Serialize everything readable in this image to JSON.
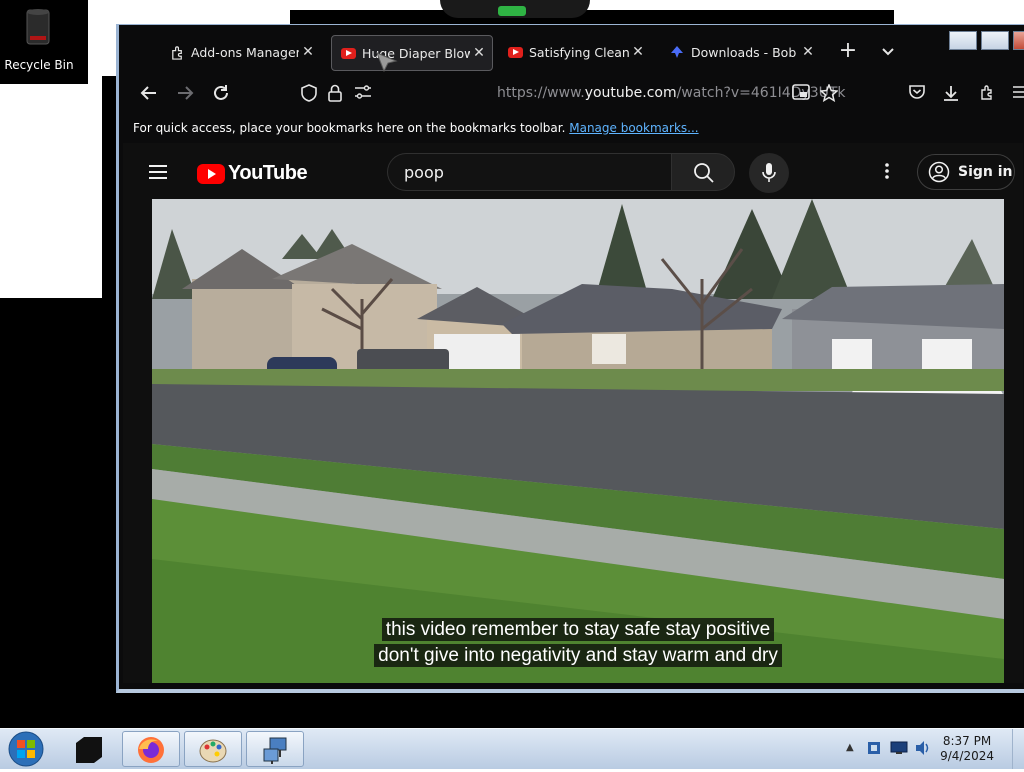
{
  "desktop": {
    "recycle_bin_label": "Recycle Bin"
  },
  "browser": {
    "tabs": [
      {
        "label": "Add-ons Manager",
        "icon": "puzzle-icon",
        "active": false
      },
      {
        "label": "Huge Diaper Blowo",
        "icon": "youtube-icon",
        "active": true
      },
      {
        "label": "Satisfying Cleaning/",
        "icon": "youtube-icon",
        "active": false
      },
      {
        "label": "Downloads - Bob Pe",
        "icon": "downloads-icon",
        "active": false
      }
    ],
    "url": {
      "prefix": "https://www.",
      "host": "youtube.com",
      "path": "/watch?v=461I4Dy3UTk"
    },
    "bookmarks_bar": {
      "message": "For quick access, place your bookmarks here on the bookmarks toolbar.",
      "link": "Manage bookmarks..."
    }
  },
  "youtube": {
    "logo_text": "YouTube",
    "search_value": "poop",
    "sign_in_label": "Sign in",
    "captions": [
      "this video remember to stay safe stay positive",
      "don't give into negativity and stay warm and dry"
    ]
  },
  "taskbar": {
    "time": "8:37 PM",
    "date": "9/4/2024"
  },
  "colors": {
    "youtube_red": "#ff0000",
    "link_blue": "#5fb4ff",
    "browser_bg": "#0b0b0c"
  }
}
